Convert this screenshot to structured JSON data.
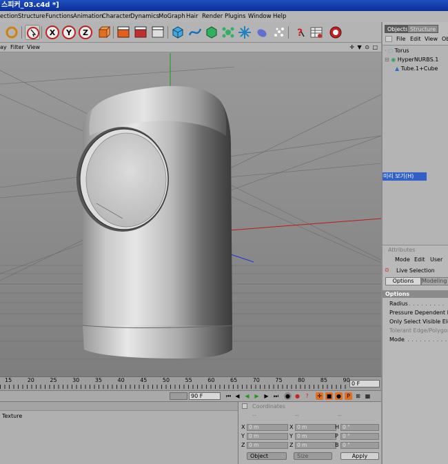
{
  "window": {
    "title": "스피커_03.c4d *]"
  },
  "menu": [
    "ection",
    "Structure",
    "Functions",
    "Animation",
    "Character",
    "Dynamics",
    "MoGraph",
    "Hair",
    "Render",
    "Plugins",
    "Window",
    "Help"
  ],
  "toolbar_icons": [
    "undo-icon",
    "live-selection-icon",
    "x-axis-icon",
    "y-axis-icon",
    "z-axis-icon",
    "world-coords-icon",
    "render-region-icon",
    "render-view-icon",
    "render-settings-icon",
    "cube-icon",
    "spline-icon",
    "nurbs-icon",
    "array-icon",
    "deformer-icon",
    "scene-icon",
    "light-particles-icon",
    "help-icon",
    "tags-icon",
    "web-icon"
  ],
  "axis_labels": {
    "x": "X",
    "y": "Y",
    "z": "Z"
  },
  "viewport_menu": {
    "display": "ay",
    "filter": "Filter",
    "view": "View",
    "nav_icons": "✛ ▼ ⊙ □"
  },
  "objects_panel": {
    "tabs": [
      "Objects",
      "Structure"
    ],
    "menu": [
      "File",
      "Edit",
      "View",
      "Ob"
    ],
    "items": [
      {
        "name": "Torus",
        "icon": "torus-icon"
      },
      {
        "name": "HyperNURBS.1",
        "icon": "hypernurbs-icon"
      },
      {
        "name": "Tube.1+Cube",
        "icon": "polygon-icon"
      }
    ],
    "preview_tooltip": "미리 보기(H)"
  },
  "attributes_panel": {
    "title": "Attributes",
    "menu": [
      "Mode",
      "Edit",
      "User"
    ],
    "tool": "Live Selection",
    "tabs": [
      "Options",
      "Modeling Ax"
    ],
    "section": "Options",
    "rows": [
      "Radius",
      "Pressure Dependent Radi",
      "Only Select Visible Eleme",
      "Tolerant Edge/Polygon Se",
      "Mode"
    ]
  },
  "timeline": {
    "ticks": [
      "15",
      "20",
      "25",
      "30",
      "35",
      "40",
      "45",
      "50",
      "55",
      "60",
      "65",
      "70",
      "75",
      "80",
      "85",
      "90"
    ],
    "end_frame": "0 F"
  },
  "transport": {
    "current_frame": "0 F",
    "max_frame": "90 F"
  },
  "material_panel": {
    "tab": "Texture"
  },
  "coordinates_panel": {
    "title": "Coordinates",
    "col_headers": [
      "--",
      "--",
      "--"
    ],
    "rows": [
      {
        "a": "X",
        "av": "0 m",
        "b": "X",
        "bv": "0 m",
        "c": "H",
        "cv": "0 °"
      },
      {
        "a": "Y",
        "av": "0 m",
        "b": "Y",
        "bv": "0 m",
        "c": "P",
        "cv": "0 °"
      },
      {
        "a": "Z",
        "av": "0 m",
        "b": "Z",
        "bv": "0 m",
        "c": "B",
        "cv": "0 °"
      }
    ],
    "mode_select": "Object",
    "size_select": "Size",
    "apply": "Apply"
  },
  "colors": {
    "accent": "#3060c8",
    "x_axis": "#c01818",
    "y_axis": "#1a9a1a",
    "z_axis": "#1a30d8"
  }
}
